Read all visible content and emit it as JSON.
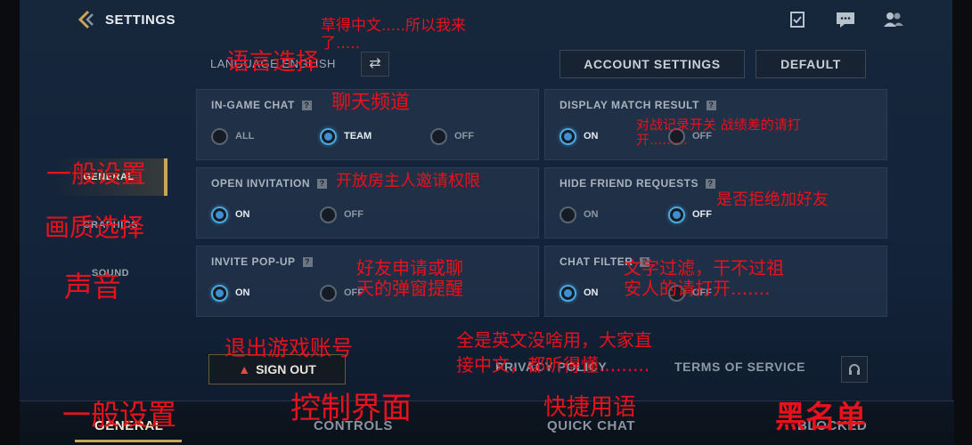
{
  "header": {
    "title": "SETTINGS",
    "icons": [
      "checklist-icon",
      "chat-icon",
      "friends-icon"
    ]
  },
  "language": {
    "label": "LANGUAGE ENGLISH"
  },
  "buttons": {
    "account_settings": "ACCOUNT SETTINGS",
    "default": "DEFAULT"
  },
  "nav": [
    {
      "label": "GENERAL"
    },
    {
      "label": "GRAPHICS"
    },
    {
      "label": "SOUND"
    }
  ],
  "cards": {
    "in_game_chat": {
      "title": "IN-GAME CHAT",
      "options": [
        "ALL",
        "TEAM",
        "OFF"
      ],
      "selected": "TEAM"
    },
    "display_match_result": {
      "title": "DISPLAY MATCH RESULT",
      "options": [
        "ON",
        "OFF"
      ],
      "selected": "ON"
    },
    "open_invitation": {
      "title": "OPEN INVITATION",
      "options": [
        "ON",
        "OFF"
      ],
      "selected": "ON"
    },
    "hide_friend_requests": {
      "title": "HIDE FRIEND REQUESTS",
      "options": [
        "ON",
        "OFF"
      ],
      "selected": "OFF"
    },
    "invite_popup": {
      "title": "INVITE POP-UP",
      "options": [
        "ON",
        "OFF"
      ],
      "selected": "ON"
    },
    "chat_filter": {
      "title": "CHAT FILTER",
      "options": [
        "ON",
        "OFF"
      ],
      "selected": "ON"
    }
  },
  "bottom": {
    "sign_out": "SIGN OUT",
    "privacy_policy": "PRIVACY POLICY",
    "terms": "TERMS OF SERVICE"
  },
  "tabs": [
    {
      "label": "GENERAL",
      "active": true
    },
    {
      "label": "CONTROLS",
      "active": false
    },
    {
      "label": "QUICK CHAT",
      "active": false
    },
    {
      "label": "BLOCKED",
      "active": false
    }
  ],
  "annotations": {
    "top": "草得中文.....所以我来\n了.....",
    "language": "语言选择",
    "in_game_chat": "聊天频道",
    "match_result": "对战记录开关 战绩差的请打\n开.........",
    "general_nav": "一般设置",
    "graphics_nav": "画质选择",
    "sound_nav": "声音",
    "open_invitation": "开放房主人邀请权限",
    "hide_friend": "是否拒绝加好友",
    "invite_popup": "好友申请或聊\n天的弹窗提醒",
    "chat_filter": "文字过滤，干不过祖\n安人的请打开.......",
    "sign_out": "退出游戏账号",
    "english": "全是英文没啥用，大家直\n接中文，都听得懂.........",
    "general_tab": "一般设置",
    "controls_tab": "控制界面",
    "quick_chat_tab": "快捷用语",
    "blocked_tab": "黑名单"
  },
  "colors": {
    "accent_gold": "#c9a55a",
    "radio_on": "#3d8fd0",
    "annotation": "#e8121c"
  }
}
